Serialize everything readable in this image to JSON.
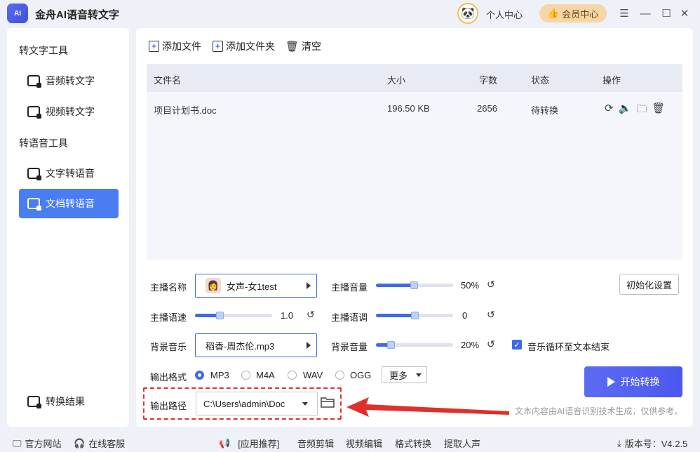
{
  "app": {
    "logo_text": "AI",
    "title": "金舟AI语音转文字"
  },
  "header": {
    "personal": "个人中心",
    "vip": "会员中心"
  },
  "sidebar": {
    "section1": "转文字工具",
    "item_audio": "音频转文字",
    "item_video": "视频转文字",
    "section2": "转语音工具",
    "item_text": "文字转语音",
    "item_doc": "文档转语音",
    "item_result": "转换结果"
  },
  "toolbar": {
    "add_file": "添加文件",
    "add_folder": "添加文件夹",
    "clear": "清空"
  },
  "table": {
    "columns": [
      "文件名",
      "大小",
      "字数",
      "状态",
      "操作"
    ],
    "rows": [
      {
        "name": "项目计划书.doc",
        "size": "196.50 KB",
        "words": "2656",
        "status": "待转换"
      }
    ]
  },
  "settings": {
    "anchor_label": "主播名称",
    "anchor_value": "女声-女1test",
    "volume_label": "主播音量",
    "volume_value": "50%",
    "volume_level": 0.5,
    "speed_label": "主播语速",
    "speed_value": "1.0",
    "pitch_label": "主播语调",
    "pitch_value": "0",
    "bgm_label": "背景音乐",
    "bgm_value": "稻香-周杰伦.mp3",
    "bgm_volume_label": "背景音量",
    "bgm_volume_value": "20%",
    "bgm_volume_level": 0.2,
    "init_button": "初始化设置",
    "loop_label": "音乐循环至文本结束",
    "format_label": "输出格式",
    "formats": [
      "MP3",
      "M4A",
      "WAV",
      "OGG"
    ],
    "more": "更多",
    "path_label": "输出路径",
    "path_value": "C:\\Users\\admin\\Doc",
    "start_button": "开始转换",
    "note": "文本内容由AI语音识别技术生成，仅供参考。"
  },
  "footer": {
    "website": "官方网站",
    "support": "在线客服",
    "recommend": "[应用推荐]",
    "links": [
      "音频剪辑",
      "视频编辑",
      "格式转换",
      "提取人声"
    ],
    "version": "版本号：V4.2.5"
  },
  "colors": {
    "accent": "#3d6be8",
    "sidebar_active": "#4a7cf2",
    "annotation": "#e0302a"
  }
}
